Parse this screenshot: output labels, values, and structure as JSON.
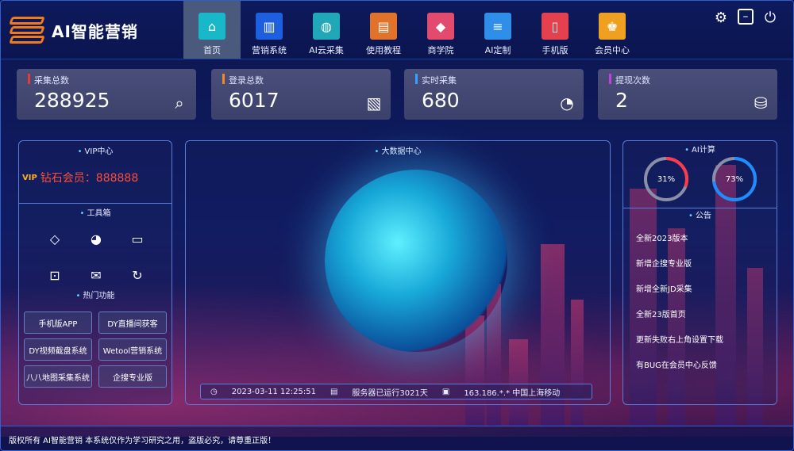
{
  "app": {
    "title": "AI智能营销"
  },
  "nav": [
    {
      "label": "首页",
      "color": "#19b8c8",
      "glyph": "⌂",
      "active": true
    },
    {
      "label": "营销系统",
      "color": "#1e5fe0",
      "glyph": "▥",
      "active": false
    },
    {
      "label": "AI云采集",
      "color": "#20a8b8",
      "glyph": "◍",
      "active": false
    },
    {
      "label": "使用教程",
      "color": "#e0722a",
      "glyph": "▤",
      "active": false
    },
    {
      "label": "商学院",
      "color": "#e24a6e",
      "glyph": "◆",
      "active": false
    },
    {
      "label": "AI定制",
      "color": "#2f8fe8",
      "glyph": "≡",
      "active": false
    },
    {
      "label": "手机版",
      "color": "#e5404e",
      "glyph": "▯",
      "active": false
    },
    {
      "label": "会员中心",
      "color": "#f0a020",
      "glyph": "♚",
      "active": false
    }
  ],
  "sys": {
    "settings_icon": "gear-icon",
    "minimize_icon": "minimize-icon",
    "power_icon": "power-icon"
  },
  "stats": [
    {
      "label": "采集总数",
      "value": "288925",
      "color": "#e53a3a",
      "icon": "⌕"
    },
    {
      "label": "登录总数",
      "value": "6017",
      "color": "#f08a24",
      "icon": "▧"
    },
    {
      "label": "实时采集",
      "value": "680",
      "color": "#3aa0ff",
      "icon": "◔"
    },
    {
      "label": "提现次数",
      "value": "2",
      "color": "#c040e0",
      "icon": "⛁"
    }
  ],
  "vip": {
    "title": "VIP中心",
    "tag": "VIP",
    "text": "钻石会员：888888"
  },
  "toolbox": {
    "title": "工具箱",
    "tools": [
      "diamond-icon",
      "palette-icon",
      "monitor-download-icon",
      "safe-icon",
      "mail-icon",
      "refresh-icon"
    ]
  },
  "hot": {
    "title": "热门功能",
    "items": [
      "手机版APP",
      "DY直播间获客",
      "DY视频截盘系统",
      "Wetool营销系统",
      "八八地图采集系统",
      "企搜专业版"
    ]
  },
  "center": {
    "title": "大数据中心",
    "time": "2023-03-11 12:25:51",
    "uptime": "服务器已运行3021天",
    "ip": "163.186.*.* 中国上海移动"
  },
  "ai": {
    "title": "AI计算",
    "gauges": [
      {
        "pct": "31%",
        "value": 0.31,
        "color": "#ff3a4a"
      },
      {
        "pct": "73%",
        "value": 0.73,
        "color": "#1e8cff"
      }
    ]
  },
  "notice": {
    "title": "公告",
    "items": [
      "全新2023版本",
      "新增企搜专业版",
      "新增全新JD采集",
      "全新23版首页",
      "更新失败右上角设置下载",
      "有BUG在会员中心反馈"
    ]
  },
  "footer": {
    "text": "版权所有 AI智能营销 本系统仅作为学习研究之用，盗版必究，请尊重正版！"
  }
}
